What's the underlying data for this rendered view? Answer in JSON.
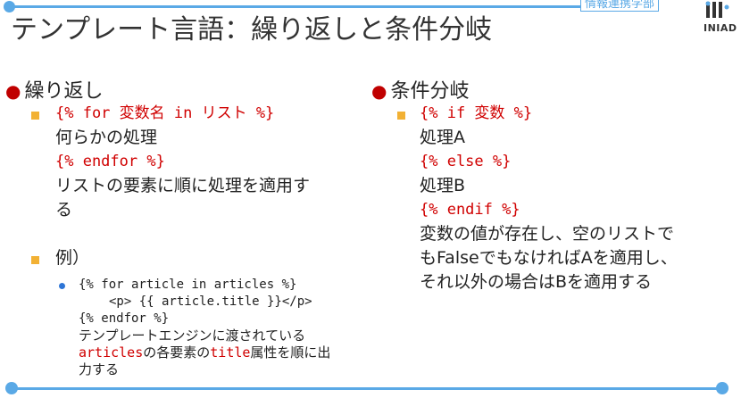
{
  "header": {
    "title": "テンプレート言語：繰り返しと条件分岐",
    "dept_label": "情報連携学部",
    "logo_text": "INIAD"
  },
  "left": {
    "heading": "繰り返し",
    "item1": {
      "code1": "{% for 変数名 in リスト %}",
      "text1": "何らかの処理",
      "code2": "{% endfor %}",
      "desc1": "リストの要素に順に処理を適用す",
      "desc2": "る"
    },
    "item2": {
      "label": "例）",
      "code1": "{% for article in articles %}",
      "code2": "<p> {{ article.title }}</p>",
      "code3": "{% endfor %}",
      "desc1": "テンプレートエンジンに渡されている",
      "desc2_code1": "articles",
      "desc2_text1": "の各要素の",
      "desc2_code2": "title",
      "desc2_text2": "属性を順に出",
      "desc3": "力する"
    }
  },
  "right": {
    "heading": "条件分岐",
    "code1": "{% if 変数 %}",
    "text1": "処理A",
    "code2": "{% else %}",
    "text2": "処理B",
    "code3": "{% endif %}",
    "desc1": "変数の値が存在し、空のリストで",
    "desc2": "もFalseでもなければAを適用し、",
    "desc3": "それ以外の場合はBを適用する"
  },
  "colors": {
    "accent_line": "#5aa9e6",
    "heading_bullet": "#c00000",
    "sub_bullet": "#f2b134",
    "code": "#d00000"
  }
}
